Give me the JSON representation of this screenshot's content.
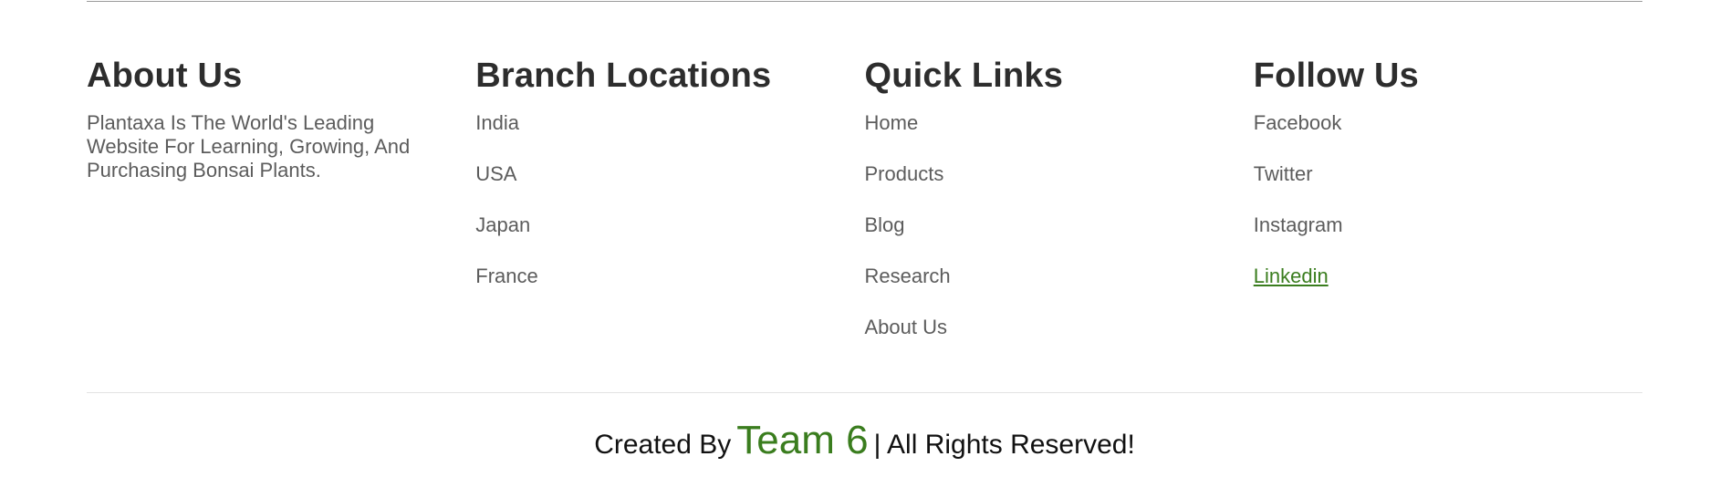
{
  "about": {
    "heading": "About Us",
    "text": "Plantaxa Is The World's Leading Website For Learning, Growing, And Purchasing Bonsai Plants."
  },
  "branches": {
    "heading": "Branch Locations",
    "items": [
      "India",
      "USA",
      "Japan",
      "France"
    ]
  },
  "quick_links": {
    "heading": "Quick Links",
    "items": [
      "Home",
      "Products",
      "Blog",
      "Research",
      "About Us"
    ]
  },
  "follow": {
    "heading": "Follow Us",
    "items": [
      "Facebook",
      "Twitter",
      "Instagram",
      "Linkedin"
    ]
  },
  "credit": {
    "prefix": "Created By",
    "team": "Team 6",
    "suffix": "| All Rights Reserved!"
  },
  "colors": {
    "accent": "#3a7d1e",
    "heading": "#2d2d2d",
    "text": "#5c5c5c"
  }
}
